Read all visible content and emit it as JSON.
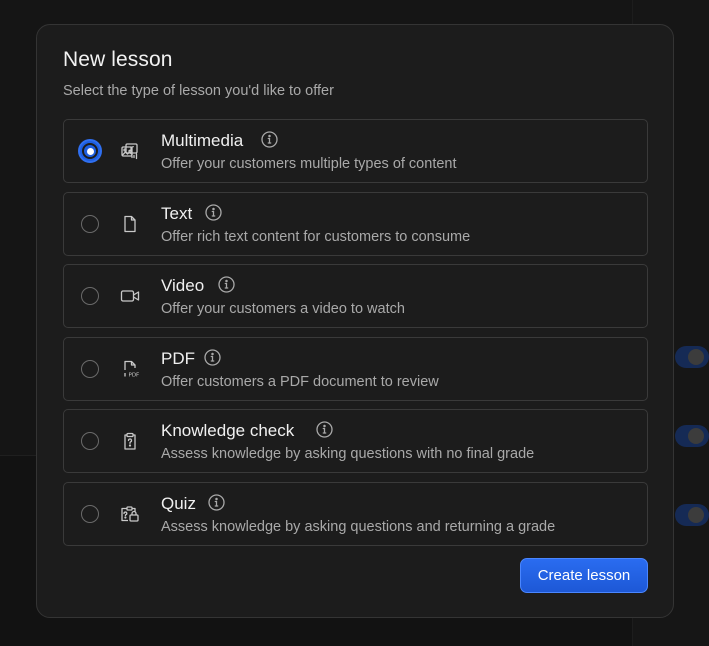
{
  "modal": {
    "title": "New lesson",
    "subtitle": "Select the type of lesson you'd like to offer",
    "selected_index": 0,
    "accent_color": "#2f6ff0",
    "options": [
      {
        "label": "Multimedia",
        "description": "Offer your customers multiple types of content",
        "icon": "multimedia-icon",
        "selected": true
      },
      {
        "label": "Text",
        "description": "Offer rich text content for customers to consume",
        "icon": "document-icon",
        "selected": false
      },
      {
        "label": "Video",
        "description": "Offer your customers a video to watch",
        "icon": "video-camera-icon",
        "selected": false
      },
      {
        "label": "PDF",
        "description": "Offer customers a PDF document to review",
        "icon": "pdf-file-icon",
        "selected": false
      },
      {
        "label": "Knowledge check",
        "description": "Assess knowledge by asking questions with no final grade",
        "icon": "clipboard-question-icon",
        "selected": false
      },
      {
        "label": "Quiz",
        "description": "Assess knowledge by asking questions and returning a grade",
        "icon": "quiz-icon",
        "selected": false
      }
    ],
    "create_label": "Create lesson"
  }
}
